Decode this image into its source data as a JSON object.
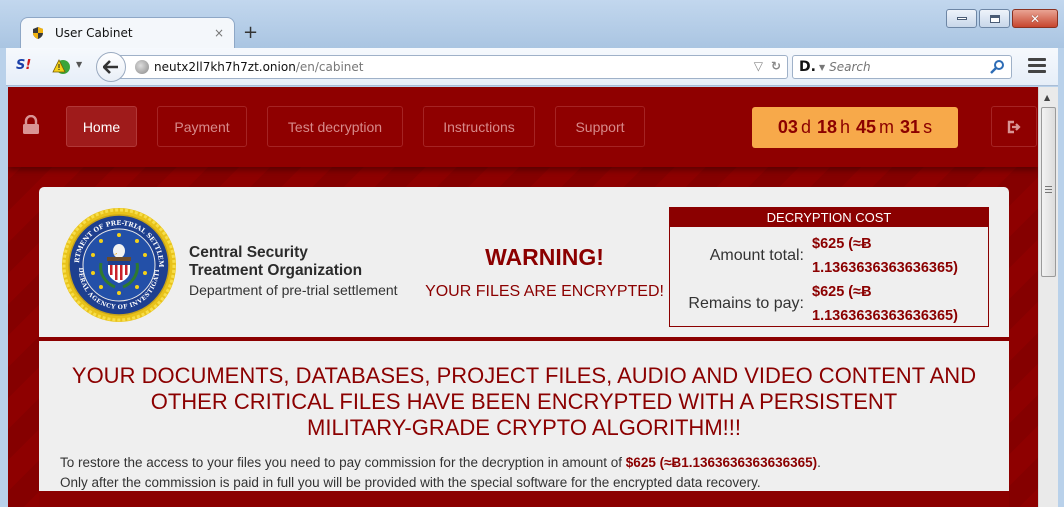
{
  "browser": {
    "tab": {
      "title": "User Cabinet",
      "close_glyph": "×"
    },
    "new_tab_glyph": "+",
    "addressbar": {
      "host": "neutx2ll7kh7h7zt.onion",
      "path": "/en/cabinet"
    },
    "search": {
      "placeholder": "Search",
      "engine_logo": "D."
    },
    "toolbar_s_logo": "S",
    "toolbar_s_logo_mark": "!"
  },
  "site": {
    "nav": {
      "items": [
        {
          "label": "Home",
          "active": true
        },
        {
          "label": "Payment",
          "active": false
        },
        {
          "label": "Test decryption",
          "active": false
        },
        {
          "label": "Instructions",
          "active": false
        },
        {
          "label": "Support",
          "active": false
        }
      ]
    },
    "timer": {
      "days": "03",
      "days_unit": "d",
      "hours": "18",
      "hours_unit": "h",
      "minutes": "45",
      "minutes_unit": "m",
      "seconds": "31",
      "seconds_unit": "s"
    },
    "header": {
      "org_line1": "Central Security",
      "org_line2": "Treatment Organization",
      "org_dept": "Department of pre-trial settlement",
      "seal_top_text": "DEPARTMENT OF PRE-TRIAL SETTLEMENT",
      "seal_bottom_text": "FEDERAL AGENCY OF INVESTIGATION",
      "warning_title": "WARNING!",
      "warning_sub": "YOUR FILES ARE ENCRYPTED!"
    },
    "cost": {
      "title": "DECRYPTION COST",
      "rows": [
        {
          "label": "Amount total:",
          "value_line1": "$625 (≈Ƀ",
          "value_line2": "1.1363636363636365)"
        },
        {
          "label": "Remains to pay:",
          "value_line1": "$625 (≈Ƀ",
          "value_line2": "1.1363636363636365)"
        }
      ]
    },
    "main": {
      "headline_line1": "YOUR DOCUMENTS, DATABASES, PROJECT FILES, AUDIO AND VIDEO CONTENT AND",
      "headline_line2": "OTHER CRITICAL FILES HAVE BEEN ENCRYPTED WITH A PERSISTENT",
      "headline_line3": "MILITARY-GRADE CRYPTO ALGORITHM!!!",
      "para1_prefix": "To restore the access to your files you need to pay commission for the decryption in amount of ",
      "para1_amount": "$625 (≈Ƀ1.1363636363636365)",
      "para1_suffix": ".",
      "para2": "Only after the commission is paid in full you will be provided with the special software for the encrypted data recovery."
    },
    "colors": {
      "brand_red": "#8b0000",
      "timer_bg": "#f7a94a",
      "panel_bg": "#efefef"
    }
  }
}
